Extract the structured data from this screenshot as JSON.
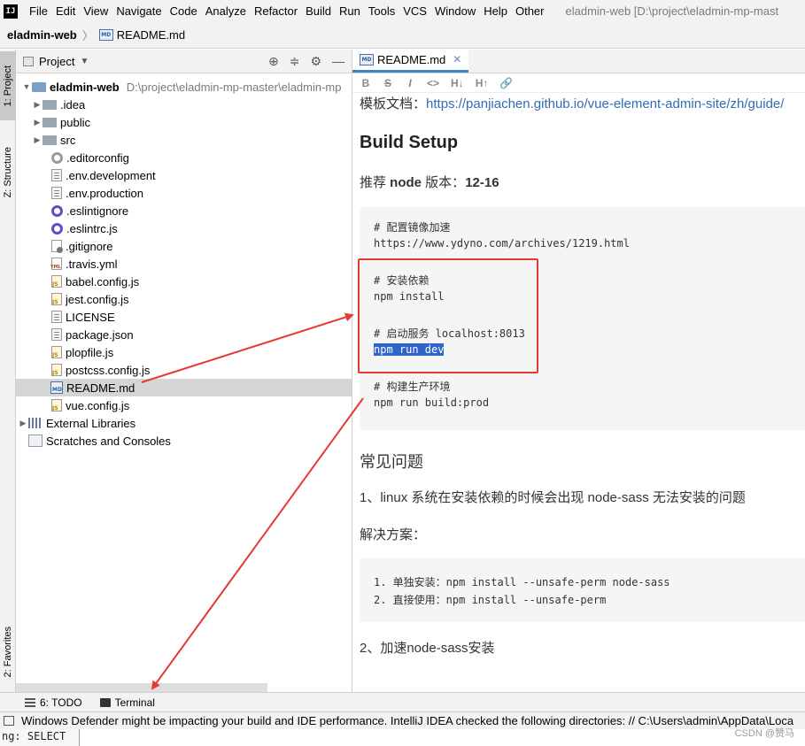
{
  "menubar": {
    "logo": "IJ",
    "items": [
      "File",
      "Edit",
      "View",
      "Navigate",
      "Code",
      "Analyze",
      "Refactor",
      "Build",
      "Run",
      "Tools",
      "VCS",
      "Window",
      "Help",
      "Other"
    ],
    "window_title": "eladmin-web [D:\\project\\eladmin-mp-mast"
  },
  "breadcrumb": {
    "project": "eladmin-web",
    "separator": "〉",
    "file": "README.md"
  },
  "tool_windows": {
    "left": [
      "1: Project",
      "Z: Structure",
      "2: Favorites"
    ],
    "bottom": [
      {
        "label": "6: TODO",
        "icon": "todo-list-icon"
      },
      {
        "label": "Terminal",
        "icon": "terminal-icon"
      }
    ]
  },
  "project_panel": {
    "title": "Project",
    "dropdown_icon": "chevron-down-icon",
    "header_icons": [
      "locate-icon",
      "collapse-icon",
      "gear-icon",
      "minimize-icon"
    ],
    "root": {
      "name": "eladmin-web",
      "path": "D:\\project\\eladmin-mp-master\\eladmin-mp"
    },
    "items": [
      {
        "name": ".idea",
        "icon": "folder-icon",
        "expandable": true
      },
      {
        "name": "public",
        "icon": "folder-icon",
        "expandable": true
      },
      {
        "name": "src",
        "icon": "folder-icon",
        "expandable": true
      },
      {
        "name": ".editorconfig",
        "icon": "config-file-icon"
      },
      {
        "name": ".env.development",
        "icon": "text-file-icon"
      },
      {
        "name": ".env.production",
        "icon": "text-file-icon"
      },
      {
        "name": ".eslintignore",
        "icon": "eslint-icon"
      },
      {
        "name": ".eslintrc.js",
        "icon": "eslint-icon"
      },
      {
        "name": ".gitignore",
        "icon": "git-file-icon"
      },
      {
        "name": ".travis.yml",
        "icon": "yml-file-icon"
      },
      {
        "name": "babel.config.js",
        "icon": "js-file-icon"
      },
      {
        "name": "jest.config.js",
        "icon": "js-file-icon"
      },
      {
        "name": "LICENSE",
        "icon": "text-file-icon"
      },
      {
        "name": "package.json",
        "icon": "text-file-icon"
      },
      {
        "name": "plopfile.js",
        "icon": "js-file-icon"
      },
      {
        "name": "postcss.config.js",
        "icon": "js-file-icon"
      },
      {
        "name": "README.md",
        "icon": "markdown-file-icon",
        "selected": true
      },
      {
        "name": "vue.config.js",
        "icon": "js-file-icon"
      }
    ],
    "external_libraries": "External Libraries",
    "scratches": "Scratches and Consoles"
  },
  "editor": {
    "tab": {
      "label": "README.md",
      "close": "✕"
    },
    "toolbar": [
      "B",
      "S",
      "I",
      "<>",
      "H↓",
      "H↑",
      "🔗"
    ],
    "content": {
      "template_prefix": "模板文档：",
      "template_link": "https://panjiachen.github.io/vue-element-admin-site/zh/guide/",
      "build_heading": "Build Setup",
      "node_pre": "推荐 ",
      "node_bold": "node",
      "node_mid": " 版本：",
      "node_version": "12-16",
      "code_lines": [
        "# 配置镜像加速",
        "https://www.ydyno.com/archives/1219.html",
        "",
        "# 安装依赖",
        "npm install",
        "",
        "# 启动服务 localhost:8013",
        "npm run dev",
        "",
        "# 构建生产环境",
        "npm run build:prod"
      ],
      "faq_heading": "常见问题",
      "faq_item1": "1、linux 系统在安装依赖的时候会出现 node-sass 无法安装的问题",
      "solution_label": "解决方案：",
      "solution_lines": [
        "1. 单独安装：npm install --unsafe-perm node-sass",
        "2. 直接使用：npm install --unsafe-perm"
      ],
      "faq_item2": "2、加速node-sass安装"
    }
  },
  "statusbar": {
    "message": "Windows Defender might be impacting your build and IDE performance. IntelliJ IDEA checked the following directories: // C:\\Users\\admin\\AppData\\Loca"
  },
  "bottom_fragment": "ng: SELECT",
  "watermark": "CSDN @赞马",
  "colors": {
    "accent": "#4083c9",
    "selection": "#2f65ca",
    "annotation": "#e53935",
    "link": "#2f6db5"
  }
}
